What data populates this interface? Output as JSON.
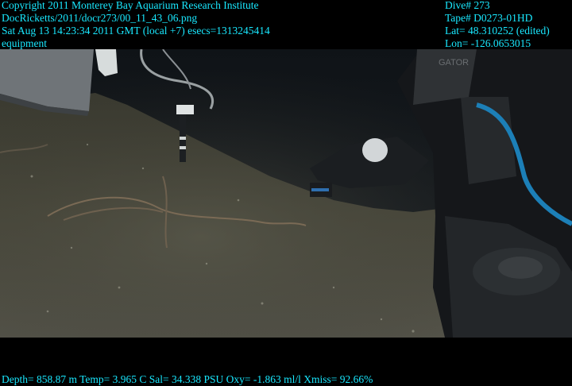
{
  "overlay": {
    "copyright": "Copyright 2011 Monterey Bay Aquarium Research Institute",
    "filename": "DocRicketts/2011/docr273/00_11_43_06.png",
    "timestamp": "Sat Aug 13 14:23:34 2011 GMT (local +7)  esecs=1313245414",
    "category": "equipment",
    "dive": "Dive# 273",
    "tape": "Tape# D0273-01HD",
    "lat": "Lat= 48.310252 (edited)",
    "lon": "Lon= -126.0653015",
    "sensors": "Depth= 858.87 m  Temp= 3.965 C  Sal= 34.338 PSU  Oxy= -1.863 ml/l  Xmiss= 92.66%"
  },
  "colors": {
    "overlay_text": "#19e8ff",
    "background": "#000000",
    "seafloor": "#4a4a3c",
    "water": "#15191d"
  },
  "robot_label": "GATOR"
}
